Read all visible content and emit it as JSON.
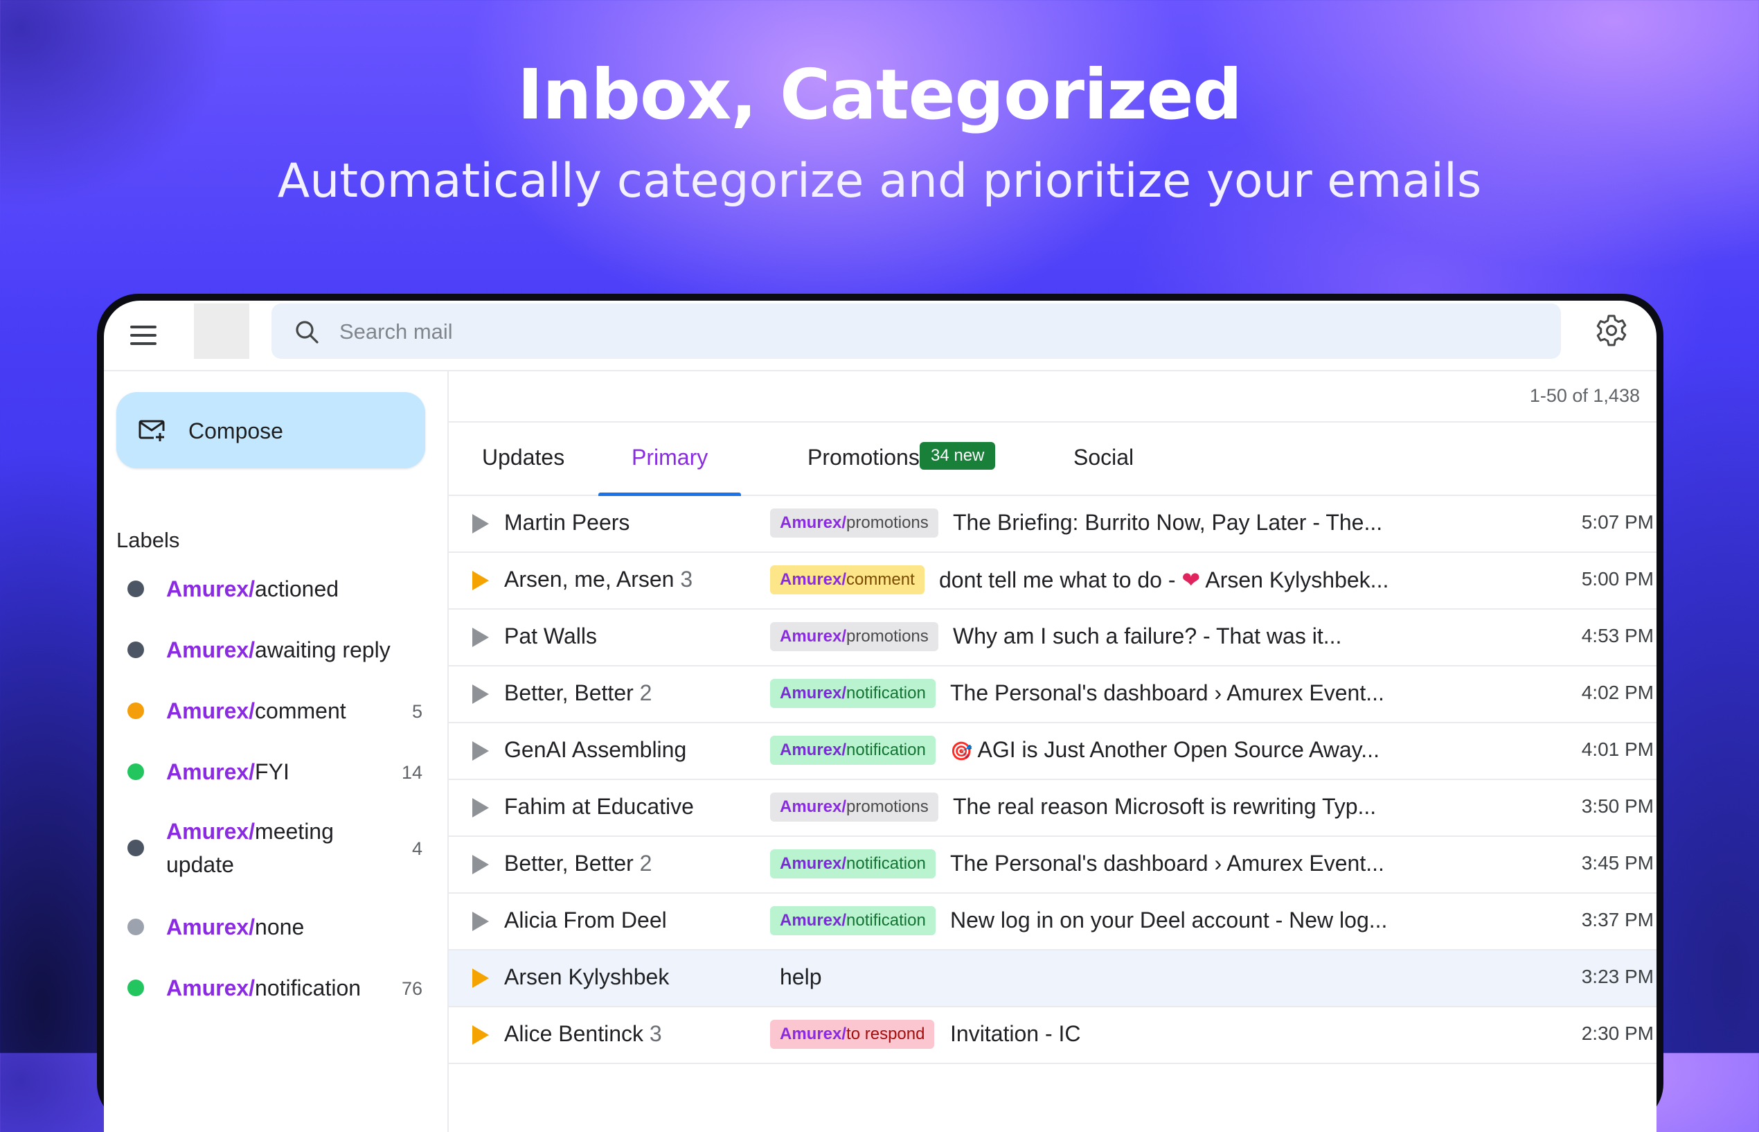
{
  "hero": {
    "title": "Inbox, Categorized",
    "subtitle": "Automatically categorize and prioritize your emails"
  },
  "search": {
    "placeholder": "Search mail"
  },
  "sidebar": {
    "compose_label": "Compose",
    "labels_heading": "Labels",
    "labels": [
      {
        "prefix": "Amurex/",
        "name": "actioned",
        "count": "",
        "color": "#4b5563"
      },
      {
        "prefix": "Amurex/",
        "name": "awaiting reply",
        "count": "",
        "color": "#4b5563"
      },
      {
        "prefix": "Amurex/",
        "name": "comment",
        "count": "5",
        "color": "#f59e0b"
      },
      {
        "prefix": "Amurex/",
        "name": "FYI",
        "count": "14",
        "color": "#22c55e"
      },
      {
        "prefix": "Amurex/",
        "name": "meeting update",
        "count": "4",
        "color": "#4b5563"
      },
      {
        "prefix": "Amurex/",
        "name": "none",
        "count": "",
        "color": "#9ca3af"
      },
      {
        "prefix": "Amurex/",
        "name": "notification",
        "count": "76",
        "color": "#22c55e"
      }
    ]
  },
  "main": {
    "pagination": "1-50 of 1,438",
    "tabs": [
      {
        "label": "Updates"
      },
      {
        "label": "Primary"
      },
      {
        "label": "Promotions",
        "badge": "34 new"
      },
      {
        "label": "Social"
      }
    ],
    "emails": [
      {
        "sender": "Martin Peers",
        "count": "",
        "important": false,
        "tag_prefix": "Amurex/",
        "tag": "promotions",
        "subject": "The Briefing: Burrito Now, Pay Later - The...",
        "time": "5:07 PM"
      },
      {
        "sender": "Arsen, me, Arsen",
        "count": "3",
        "important": true,
        "tag_prefix": "Amurex/",
        "tag": "comment",
        "subject_pre": "dont tell me what to do - ",
        "subject_emoji": "❤",
        "subject_post": " Arsen Kylyshbek...",
        "time": "5:00 PM"
      },
      {
        "sender": "Pat Walls",
        "count": "",
        "important": false,
        "tag_prefix": "Amurex/",
        "tag": "promotions",
        "subject": "Why am I such a failure? - That was it...",
        "time": "4:53 PM"
      },
      {
        "sender": "Better, Better",
        "count": "2",
        "important": false,
        "tag_prefix": "Amurex/",
        "tag": "notification",
        "subject": "The Personal's dashboard › Amurex Event...",
        "time": "4:02 PM"
      },
      {
        "sender": "GenAI Assembling",
        "count": "",
        "important": false,
        "tag_prefix": "Amurex/",
        "tag": "notification",
        "subject_emoji": "🎯",
        "subject_post": " AGI is Just Another Open Source Away...",
        "time": "4:01 PM"
      },
      {
        "sender": "Fahim at Educative",
        "count": "",
        "important": false,
        "tag_prefix": "Amurex/",
        "tag": "promotions",
        "subject": "The real reason Microsoft is rewriting Typ...",
        "time": "3:50 PM"
      },
      {
        "sender": "Better, Better",
        "count": "2",
        "important": false,
        "tag_prefix": "Amurex/",
        "tag": "notification",
        "subject": "The Personal's dashboard › Amurex Event...",
        "time": "3:45 PM"
      },
      {
        "sender": "Alicia From Deel",
        "count": "",
        "important": false,
        "tag_prefix": "Amurex/",
        "tag": "notification",
        "subject": "New log in on your Deel account - New log...",
        "time": "3:37 PM"
      },
      {
        "sender": "Arsen Kylyshbek",
        "count": "",
        "important": true,
        "subject": "help",
        "time": "3:23 PM"
      },
      {
        "sender": "Alice Bentinck",
        "count": "3",
        "important": true,
        "tag_prefix": "Amurex/",
        "tag": "to respond",
        "subject": "Invitation - IC",
        "time": "2:30 PM"
      }
    ]
  },
  "colors": {
    "brand_purple": "#8a2be2",
    "compose_bg": "#c2e7ff",
    "important_arrow": "#f4a300",
    "active_tab_underline": "#1a73e8"
  }
}
